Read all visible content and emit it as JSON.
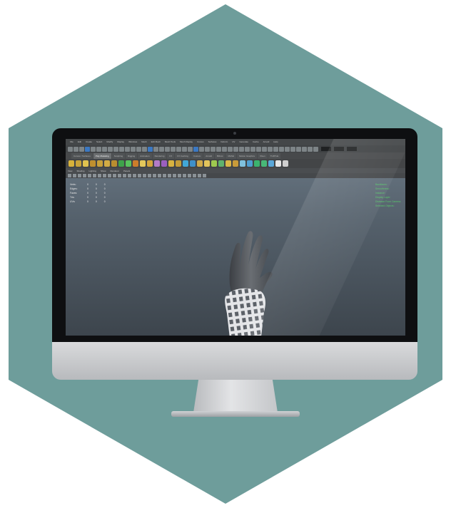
{
  "colors": {
    "hexagon": "#6e9d9b",
    "bezel": "#0e0f11",
    "viewport_top": "#6d7b88",
    "viewport_bottom": "#3d454d",
    "hud_right": "#58c96a",
    "cast": "#d9d9dc",
    "hand": "#5b5e63"
  },
  "menubar": [
    "File",
    "Edit",
    "Create",
    "Select",
    "Modify",
    "Display",
    "Windows",
    "Mesh",
    "Edit Mesh",
    "Mesh Tools",
    "Mesh Display",
    "Curves",
    "Surfaces",
    "Deform",
    "UV",
    "Generate",
    "Cache",
    "Arnold",
    "Help"
  ],
  "shelf_tabs": [
    "Curves / Surfaces",
    "Poly Modeling",
    "Sculpting",
    "Rigging",
    "Animation",
    "Rendering",
    "FX",
    "FX Caching",
    "Custom",
    "Arnold",
    "Bifrost",
    "MASH",
    "Motion Graphics",
    "XGen",
    "TURTLE"
  ],
  "active_shelf_tab_index": 1,
  "shelf_icon_colors": [
    "#d8b23a",
    "#c9a43a",
    "#e0c24f",
    "#bf8f2e",
    "#c7a03a",
    "#d1ab44",
    "#b98e2f",
    "#3ea34a",
    "#59c35d",
    "#cc7d2b",
    "#e3c75b",
    "#d2a43b",
    "#b37bc7",
    "#9b5fbf",
    "#d7b240",
    "#c39c39",
    "#42a7d6",
    "#3f90c9",
    "#cfa94a",
    "#e2c35b",
    "#9ec94f",
    "#5fb26d",
    "#d9b748",
    "#c89b3a",
    "#7fc1de",
    "#4f9ed0",
    "#3bb36f",
    "#48b877",
    "#5aa7d8",
    "#e5e5e5",
    "#cfcfcf"
  ],
  "panel_menu": [
    "View",
    "Shading",
    "Lighting",
    "Show",
    "Renderer",
    "Panels"
  ],
  "hud_left": [
    {
      "label": "Verts:",
      "v1": "0",
      "v2": "0",
      "v3": "0"
    },
    {
      "label": "Edges:",
      "v1": "0",
      "v2": "0",
      "v3": "0"
    },
    {
      "label": "Faces:",
      "v1": "0",
      "v2": "0",
      "v3": "0"
    },
    {
      "label": "Tris:",
      "v1": "0",
      "v2": "0",
      "v3": "0"
    },
    {
      "label": "UVs:",
      "v1": "0",
      "v2": "0",
      "v3": "0"
    }
  ],
  "hud_right": [
    "Backfaces:",
    "Smoothness:",
    "Instance:",
    "Display Layer:",
    "Distance From Camera:",
    "Selected Objects:"
  ],
  "scene": {
    "object": "hand with lattice cast"
  }
}
